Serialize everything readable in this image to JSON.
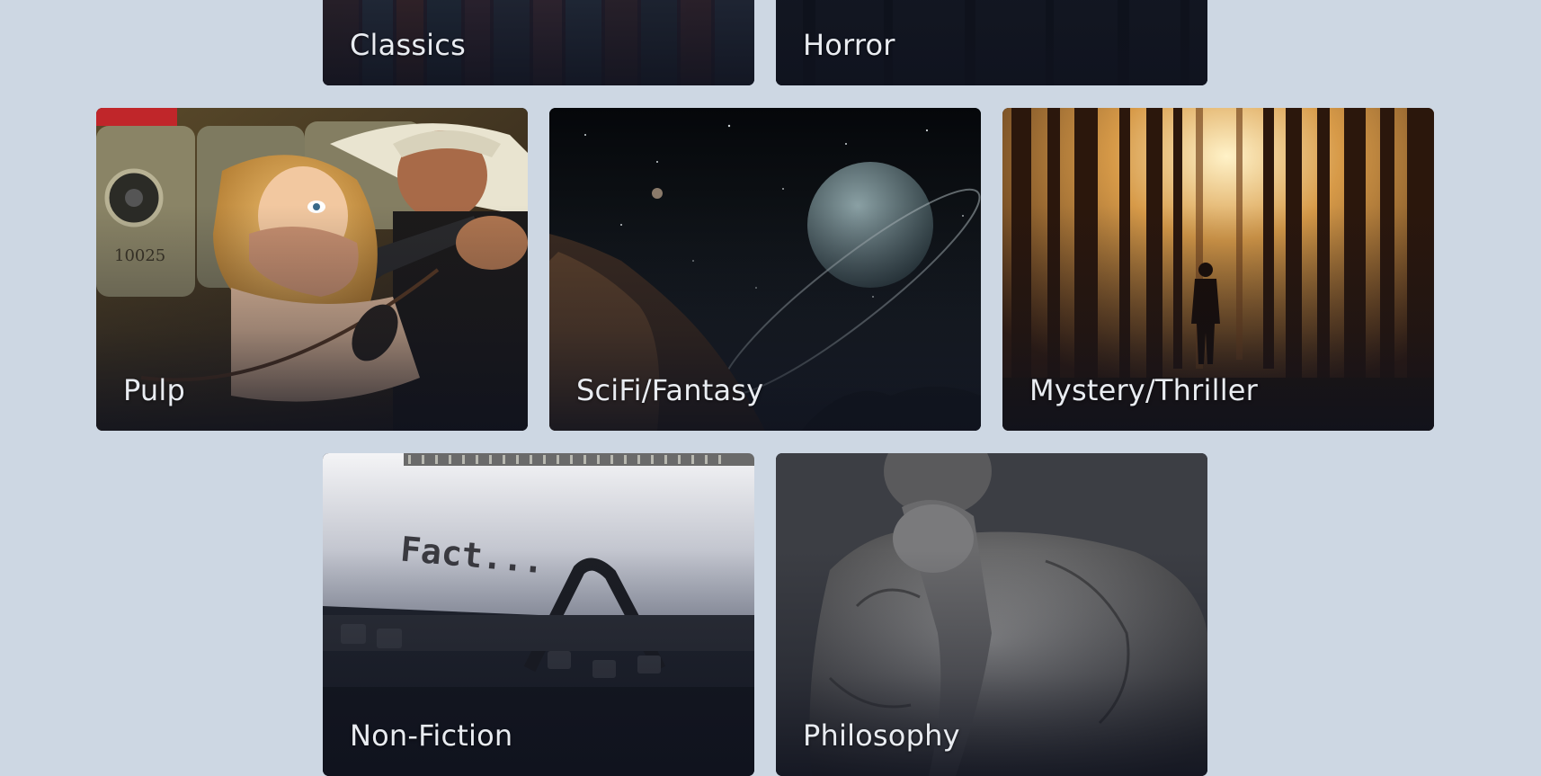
{
  "categories": [
    {
      "id": "classics",
      "label": "Classics",
      "icon": "bookshelf-image"
    },
    {
      "id": "horror",
      "label": "Horror",
      "icon": "dark-forest-image"
    },
    {
      "id": "pulp",
      "label": "Pulp",
      "icon": "pulp-cover-image"
    },
    {
      "id": "scifi",
      "label": "SciFi/Fantasy",
      "icon": "ringed-planet-image"
    },
    {
      "id": "mystery",
      "label": "Mystery/Thriller",
      "icon": "misty-forest-image"
    },
    {
      "id": "nonfiction",
      "label": "Non-Fiction",
      "icon": "typewriter-image"
    },
    {
      "id": "philosophy",
      "label": "Philosophy",
      "icon": "thinker-statue-image"
    }
  ],
  "typewriter_text": "Fact...",
  "pulp_plate_text": "10025",
  "colors": {
    "background": "#cdd7e3",
    "label": "#e9ecf1",
    "card_shade": "#0f121e"
  }
}
